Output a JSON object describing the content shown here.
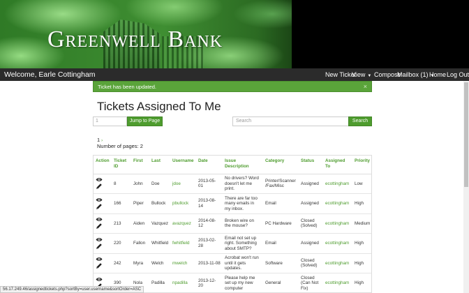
{
  "banner": {
    "title": "Greenwell Bank"
  },
  "navbar": {
    "welcome": "Welcome, Earle Cottingham",
    "items": [
      {
        "label": "New Ticket",
        "caret": false
      },
      {
        "label": "View",
        "caret": true
      },
      {
        "label": "Compose",
        "caret": false
      },
      {
        "label": "Mailbox (1)",
        "caret": true
      },
      {
        "label": "Home",
        "caret": false
      },
      {
        "label": "Log Out",
        "caret": false
      }
    ]
  },
  "alert": {
    "message": "Ticket has been updated.",
    "close": "×"
  },
  "page": {
    "title": "Tickets Assigned To Me"
  },
  "pager": {
    "input_value": "1",
    "jump_label": "Jump to Page"
  },
  "search": {
    "placeholder": "Search",
    "button_label": "Search"
  },
  "meta": {
    "current_page": "1",
    "page_count_label": "Number of pages: 2"
  },
  "table": {
    "headers": {
      "action": "Action",
      "ticket_id": "Ticket ID",
      "first": "First",
      "last": "Last",
      "username": "Username",
      "date": "Date",
      "issue": "Issue Description",
      "category": "Category",
      "status": "Status",
      "assigned": "Assigned To",
      "priority": "Priority"
    },
    "rows": [
      {
        "id": "8",
        "first": "John",
        "last": "Doe",
        "username": "jdoe",
        "date": "2013-05-01",
        "issue": "No drivers? Word doesn't let me print.",
        "category": "Printer/Scanner /Fax/Misc",
        "status": "Assigned",
        "assigned": "ecottingham",
        "priority": "Low"
      },
      {
        "id": "166",
        "first": "Piper",
        "last": "Bullock",
        "username": "pbullock",
        "date": "2013-08-14",
        "issue": "There are far too many emails in my inbox.",
        "category": "Email",
        "status": "Assigned",
        "assigned": "ecottingham",
        "priority": "High"
      },
      {
        "id": "213",
        "first": "Aiden",
        "last": "Vazquez",
        "username": "avazquez",
        "date": "2014-08-12",
        "issue": "Broken wire on the mouse?",
        "category": "PC Hardware",
        "status": "Closed (Solved)",
        "assigned": "ecottingham",
        "priority": "Medium"
      },
      {
        "id": "220",
        "first": "Fallon",
        "last": "Whitfield",
        "username": "fwhitfield",
        "date": "2013-02-28",
        "issue": "Email not set up right. Something about SMTP?",
        "category": "Email",
        "status": "Assigned",
        "assigned": "ecottingham",
        "priority": "High"
      },
      {
        "id": "242",
        "first": "Myra",
        "last": "Welch",
        "username": "mwelch",
        "date": "2013-11-08",
        "issue": "Acrobat won't run until it gets updates.",
        "category": "Software",
        "status": "Closed (Solved)",
        "assigned": "ecottingham",
        "priority": "High"
      },
      {
        "id": "390",
        "first": "Nola",
        "last": "Padilla",
        "username": "npadilla",
        "date": "2013-12-20",
        "issue": "Please help me set up my new computer",
        "category": "General",
        "status": "Closed (Can Not Fix)",
        "assigned": "ecottingham",
        "priority": "High"
      }
    ]
  },
  "statusbar": {
    "url": "56.17.249.46/assignedtickets.php?sortBy=user.username&sortOrder=ASC"
  }
}
